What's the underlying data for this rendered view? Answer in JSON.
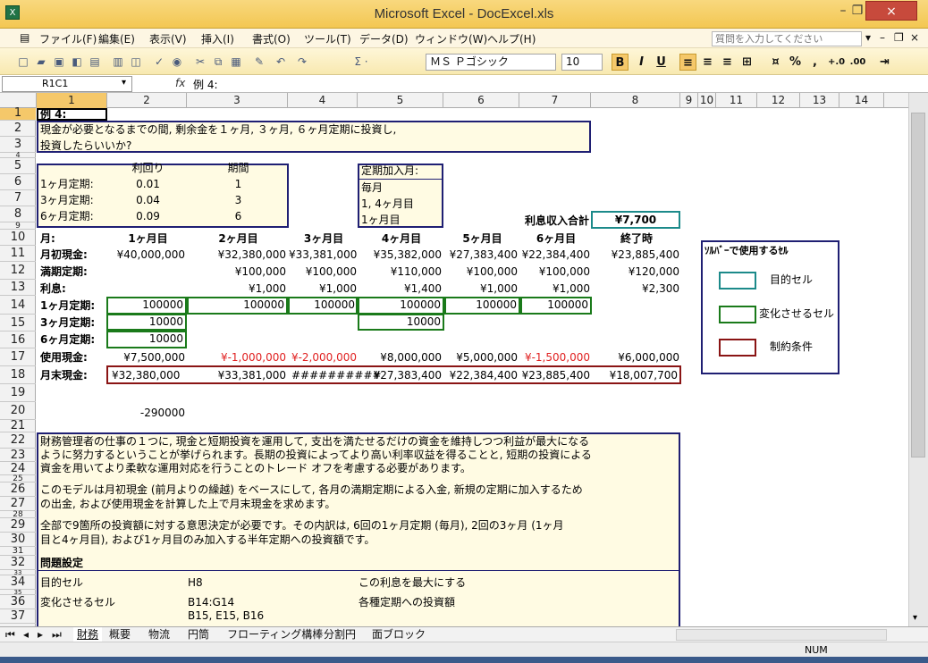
{
  "window": {
    "title": "Microsoft Excel - DocExcel.xls",
    "app_icon": "excel-icon",
    "close_glyph": "×",
    "minimize_glyph": "–",
    "restore_glyph": "❐"
  },
  "menu": {
    "items": [
      "ファイル(F)",
      "編集(E)",
      "表示(V)",
      "挿入(I)",
      "書式(O)",
      "ツール(T)",
      "データ(D)",
      "ウィンドウ(W)",
      "ヘルプ(H)"
    ],
    "help_placeholder": "質問を入力してください"
  },
  "toolbar": {
    "sigma": "Σ ·",
    "font": "ＭＳ Ｐゴシック",
    "size": "10",
    "bold": "B",
    "italic": "I",
    "underline": "U",
    "percent": "%",
    "comma": ","
  },
  "formula_bar": {
    "name_box": "R1C1",
    "fx": "fx",
    "content": "例 4:"
  },
  "columns": [
    "1",
    "2",
    "3",
    "4",
    "5",
    "6",
    "7",
    "8",
    "9",
    "10",
    "11",
    "12",
    "13",
    "14"
  ],
  "rows": [
    "1",
    "2",
    "3",
    "4",
    "5",
    "6",
    "7",
    "8",
    "9",
    "10",
    "11",
    "12",
    "13",
    "14",
    "15",
    "16",
    "17",
    "18",
    "19",
    "20",
    "21",
    "22",
    "23",
    "24",
    "25",
    "26",
    "27",
    "28",
    "29",
    "30",
    "31",
    "32",
    "33",
    "34",
    "35",
    "36",
    "37"
  ],
  "sheet": {
    "example_title": "例 4:",
    "question_line1": "現金が必要となるまでの間, 剰余金を１ヶ月, ３ヶ月, ６ヶ月定期に投資し,",
    "question_line2": "投資したらいいか?",
    "rate_table": {
      "header_yield": "利回り",
      "header_period": "期間",
      "rows": [
        {
          "label": "1ヶ月定期:",
          "yield": "0.01",
          "period": "1"
        },
        {
          "label": "3ヶ月定期:",
          "yield": "0.04",
          "period": "3"
        },
        {
          "label": "6ヶ月定期:",
          "yield": "0.09",
          "period": "6"
        }
      ]
    },
    "join_table": {
      "header": "定期加入月:",
      "rows": [
        "毎月",
        "1, 4ヶ月目",
        "1ヶ月目"
      ]
    },
    "interest_total_label": "利息収入合計",
    "interest_total_value": "¥7,700",
    "month_header": [
      "月:",
      "1ヶ月目",
      "2ヶ月目",
      "3ヶ月目",
      "4ヶ月目",
      "5ヶ月目",
      "6ヶ月目",
      "終了時"
    ],
    "cash_start": {
      "label": "月初現金:",
      "values": [
        "¥40,000,000",
        "¥32,380,000",
        "¥33,381,000",
        "¥35,382,000",
        "¥27,383,400",
        "¥22,384,400",
        "¥23,885,400"
      ]
    },
    "maturity": {
      "label": "満期定期:",
      "values": [
        "",
        "¥100,000",
        "¥100,000",
        "¥110,000",
        "¥100,000",
        "¥100,000",
        "¥120,000"
      ]
    },
    "interest": {
      "label": "利息:",
      "values": [
        "",
        "¥1,000",
        "¥1,000",
        "¥1,400",
        "¥1,000",
        "¥1,000",
        "¥2,300"
      ]
    },
    "one_month": {
      "label": "1ヶ月定期:",
      "values": [
        "100000",
        "100000",
        "100000",
        "100000",
        "100000",
        "100000"
      ]
    },
    "three_month": {
      "label": "3ヶ月定期:",
      "values": [
        "10000",
        "10000"
      ]
    },
    "six_month": {
      "label": "6ヶ月定期:",
      "values": [
        "10000"
      ]
    },
    "cash_used": {
      "label": "使用現金:",
      "values": [
        "¥7,500,000",
        "¥-1,000,000",
        "¥-2,000,000",
        "¥8,000,000",
        "¥5,000,000",
        "¥-1,500,000",
        "¥6,000,000"
      ]
    },
    "cash_end": {
      "label": "月末現金:",
      "values": [
        "¥32,380,000",
        "¥33,381,000",
        "##########",
        "¥27,383,400",
        "¥22,384,400",
        "¥23,885,400",
        "¥18,007,700"
      ]
    },
    "row20_value": "-290000",
    "legend": {
      "title": "ｿﾙﾊﾞｰで使用するｾﾙ",
      "target": "目的セル",
      "changing": "変化させるセル",
      "constraint": "制約条件"
    },
    "para1": [
      "財務管理者の仕事の１つに, 現金と短期投資を運用して, 支出を満たせるだけの資金を維持しつつ利益が最大になる",
      "ように努力するということが挙げられます。長期の投資によってより高い利率収益を得ることと, 短期の投資による",
      "資金を用いてより柔軟な運用対応を行うことのトレード オフを考慮する必要があります。"
    ],
    "para2": [
      "このモデルは月初現金 (前月よりの繰越) をベースにして, 各月の満期定期による入金, 新規の定期に加入するため",
      "の出金, および使用現金を計算した上で月末現金を求めます。"
    ],
    "para3": [
      "全部で9箇所の投資額に対する意思決定が必要です。その内訳は, 6回の1ヶ月定期 (毎月), 2回の3ヶ月 (1ヶ月",
      "目と4ヶ月目), および1ヶ月目のみ加入する半年定期への投資額です。"
    ],
    "problem_title": "問題設定",
    "problem": [
      {
        "label": "目的セル",
        "cell": "H8",
        "desc": "この利息を最大にする"
      },
      {
        "label": "変化させるセル",
        "cell": "B14:G14",
        "desc": "各種定期への投資額"
      }
    ],
    "problem_extra_cell": "B15, E15, B16"
  },
  "tabs": [
    "財務",
    "概要",
    "物流",
    "円筒",
    "フローティング構棒",
    "分割円",
    "面ブロック"
  ],
  "status": {
    "num": "NUM"
  },
  "colors": {
    "accent": "#f3c752",
    "box_border": "#1f1f73",
    "green": "#1a7a1a",
    "red_border": "#8a1414",
    "teal": "#1c8a8a",
    "negative": "#e02020"
  }
}
